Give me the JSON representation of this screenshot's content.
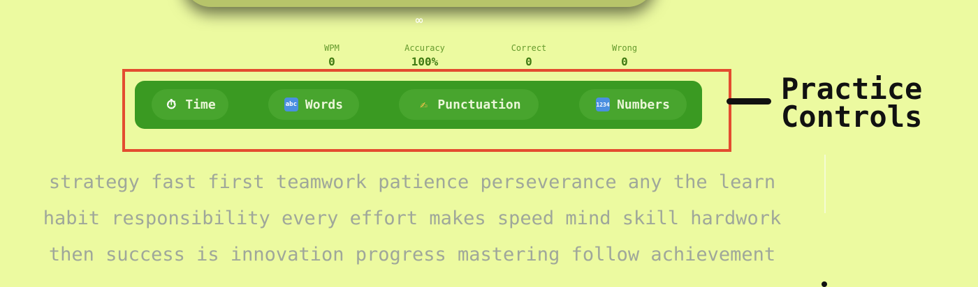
{
  "timer": {
    "symbol": "∞"
  },
  "stats": [
    {
      "label": "WPM",
      "value": "0"
    },
    {
      "label": "Accuracy",
      "value": "100%"
    },
    {
      "label": "Correct",
      "value": "0"
    },
    {
      "label": "Wrong",
      "value": "0"
    }
  ],
  "controls": [
    {
      "label": "Time",
      "icon": "stopwatch-icon",
      "glyph": "⏱"
    },
    {
      "label": "Words",
      "icon": "abc-icon",
      "glyph": "abc"
    },
    {
      "label": "Punctuation",
      "icon": "writing-hand-icon",
      "glyph": "✍"
    },
    {
      "label": "Numbers",
      "icon": "numbers-icon",
      "glyph": "1234"
    }
  ],
  "annotation": {
    "line1": "Practice",
    "line2": "Controls"
  },
  "text_lines": [
    "strategy fast first teamwork patience perseverance any the learn",
    "habit responsibility every effort makes speed mind skill hardwork",
    "then success is innovation progress mastering follow achievement"
  ],
  "colors": {
    "background": "#ecfaa0",
    "controls_bg": "#3a9a22",
    "highlight": "#e34c30",
    "text_muted": "#9fa79a"
  }
}
